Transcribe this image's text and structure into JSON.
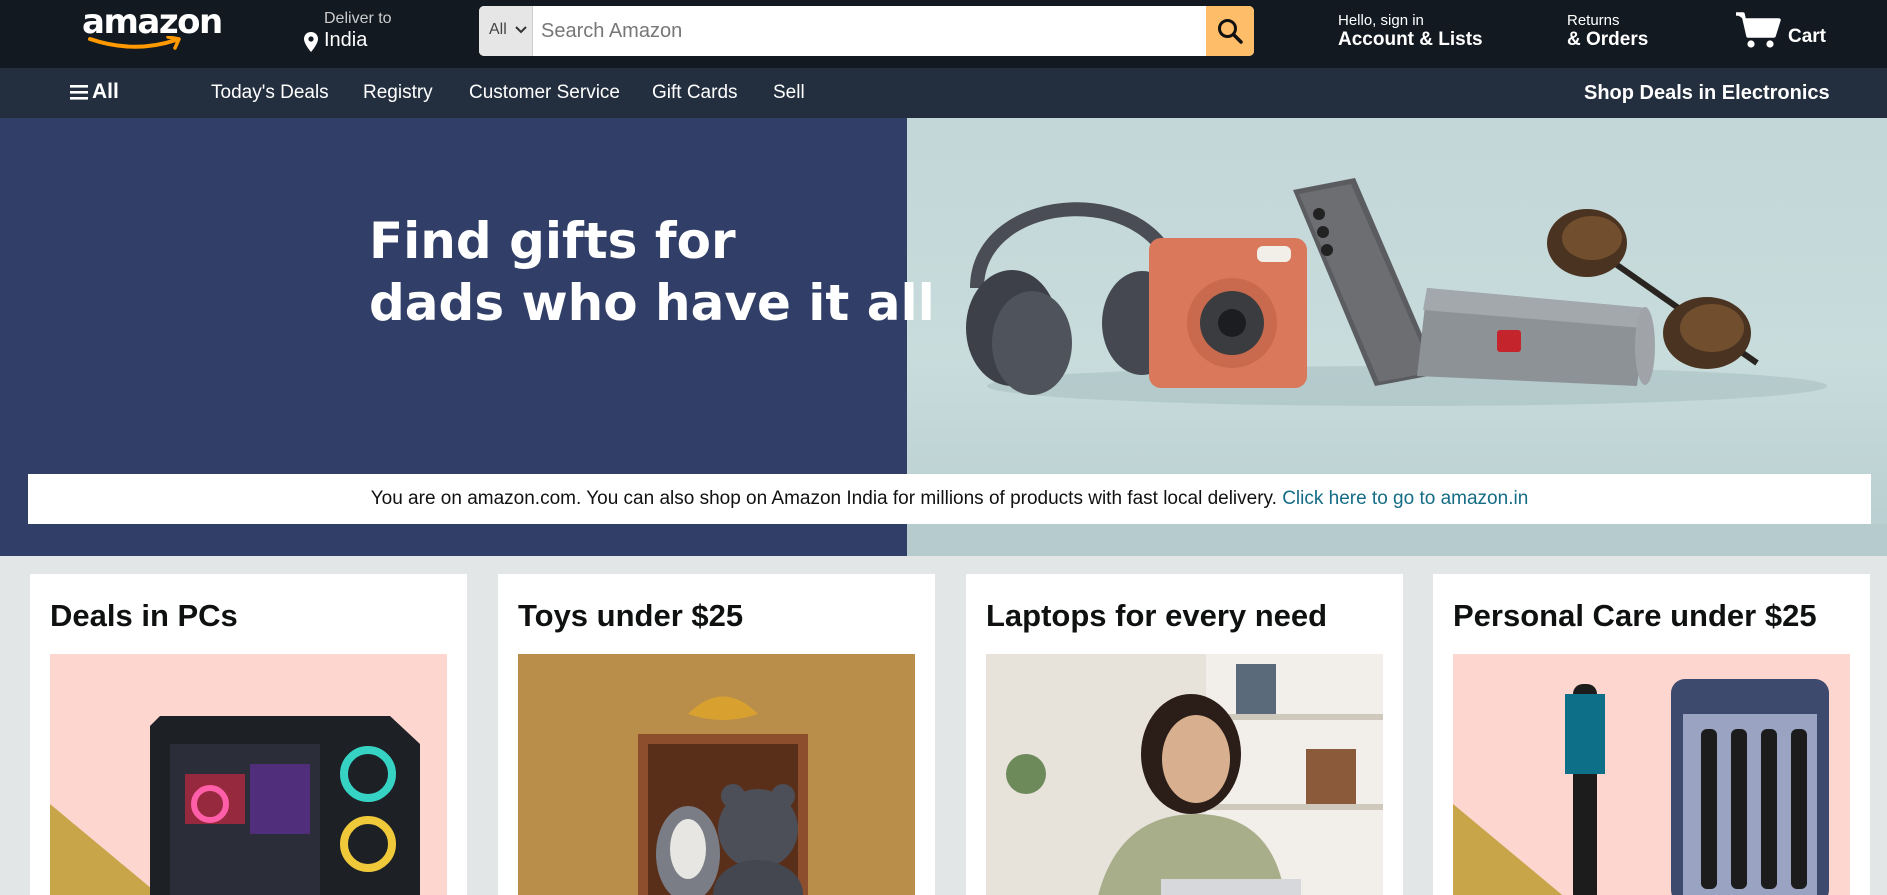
{
  "header": {
    "logo_text": "amazon",
    "deliver_label": "Deliver to",
    "deliver_location": "India",
    "search": {
      "category": "All",
      "placeholder": "Search Amazon",
      "value": ""
    },
    "account_line1": "Hello, sign in",
    "account_line2": "Account & Lists",
    "returns_line1": "Returns",
    "returns_line2": "& Orders",
    "cart_label": "Cart"
  },
  "subnav": {
    "all_label": "All",
    "links": [
      "Today's Deals",
      "Registry",
      "Customer Service",
      "Gift Cards",
      "Sell"
    ],
    "promo": "Shop Deals in Electronics"
  },
  "hero": {
    "title_line1": "Find gifts for",
    "title_line2": "dads who have it all"
  },
  "notice": {
    "text": "You are on amazon.com. You can also shop on Amazon India for millions of products with fast local delivery.",
    "link": "Click here to go to amazon.in"
  },
  "cards": [
    {
      "title": "Deals in PCs"
    },
    {
      "title": "Toys under $25"
    },
    {
      "title": "Laptops for every need"
    },
    {
      "title": "Personal Care under $25"
    }
  ],
  "colors": {
    "nav_dark": "#131921",
    "subnav": "#232f3e",
    "search_button": "#febd69",
    "hero_blue": "#313f68",
    "link_teal": "#146c86"
  },
  "icons": [
    "location-pin-icon",
    "chevron-down-icon",
    "search-icon",
    "cart-icon",
    "hamburger-icon"
  ]
}
